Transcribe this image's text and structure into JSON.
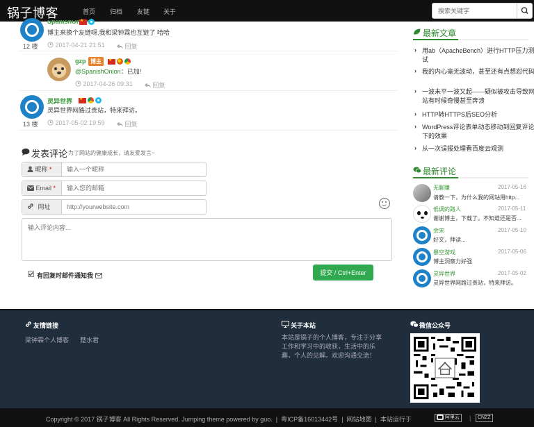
{
  "nav": {
    "brand": "锅子博客",
    "links": [
      "首页",
      "归档",
      "友链",
      "关于"
    ],
    "search_placeholder": "搜索关键字"
  },
  "comments": [
    {
      "name": "SpanishOnion",
      "text": "博主来换个友链呀,我和梁钟霖也互链了 哈哈",
      "date": "2017-04-21 21:51",
      "reply": "回复",
      "floor": "12 楼"
    },
    {
      "name": "gzp",
      "badge": "博主",
      "mention": "@SpanishOnion",
      "text": "：已加!",
      "date": "2017-04-26 09:31",
      "reply": "回复"
    },
    {
      "name": "灵异世界",
      "text": "灵异世界网路过贵站，特来拜访。",
      "date": "2017-05-02 19:59",
      "reply": "回复",
      "floor": "13 楼"
    }
  ],
  "form": {
    "title": "发表评论",
    "subtitle": "为了网站的健康成长，请友爱发言~",
    "nick_label": "昵称",
    "nick_placeholder": "输入一个昵称",
    "email_label": "Email",
    "email_placeholder": "输入您的邮箱",
    "site_label": "网址",
    "site_placeholder": "http://yourwebsite.com",
    "required_mark": "*",
    "content_placeholder": "输入评论内容...",
    "notify_label": "有回复时邮件通知我",
    "submit_label": "提交 / Ctrl+Enter"
  },
  "sidebar": {
    "latest_title": "最新文章",
    "latest_posts": [
      "用ab（ApacheBench）进行HTTP压力测试",
      "我的内心毫无波动，甚至还有点想怼代码",
      "一波未平一波又起——疑似被攻击导致网站有时候奇慢甚至奔溃",
      "HTTP转HTTPS后SEO分析",
      "WordPress评论表单动态移动到回复评论下的效果",
      "从一次误报处理看百度云观测"
    ],
    "recent_title": "最新评论",
    "recent_comments": [
      {
        "name": "无聊賺",
        "date": "2017-05-16",
        "text": "请教一下，为什么我的网站用http..."
      },
      {
        "name": "低调的路人",
        "date": "2017-05-11",
        "text": "谢谢博主，下载了。不知道还是否..."
      },
      {
        "name": "余宋",
        "date": "2017-05-10",
        "text": "好文，拜读..."
      },
      {
        "name": "暴空游戏",
        "date": "2017-05-06",
        "text": "博主洞察力好强"
      },
      {
        "name": "灵异世界",
        "date": "2017-05-02",
        "text": "灵异世界网路过贵站，特来拜访。"
      }
    ]
  },
  "footer": {
    "links_title": "友情链接",
    "links": [
      "梁钟霖个人博客",
      "楚水君"
    ],
    "about_title": "关于本站",
    "about_text": "本站是锅子的个人博客，专注于分享工作和学习中的收获，生活中的乐趣，个人的见解。欢迎沟通交流！",
    "wechat_title": "微信公众号",
    "copyright": "Copyright © 2017 锅子博客 All Rights Reserved. Jumping theme powered by guo.",
    "icp": "粤ICP备16013442号",
    "sitemap": "网站地图",
    "hosted_on": "本站运行于",
    "host_logo": "阿里云",
    "cnzz": "CNZZ"
  },
  "colors": {
    "accent_green": "#2e8b2e",
    "submit_green": "#2fa84f",
    "nav_bg": "#111111",
    "footer_bg": "#1f2d3d",
    "owner_badge": "#e8812c"
  }
}
